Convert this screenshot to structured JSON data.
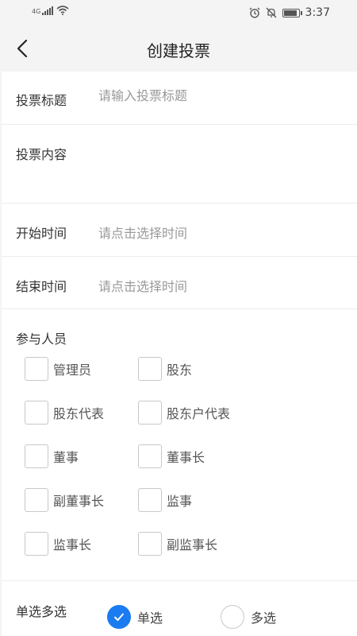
{
  "status_bar": {
    "network": "4G",
    "time": "3:37",
    "icons": [
      "signal-icon",
      "wifi-icon",
      "alarm-icon",
      "mute-icon",
      "battery-icon"
    ]
  },
  "header": {
    "title": "创建投票",
    "back_icon": "chevron-left-icon"
  },
  "form": {
    "title_field": {
      "label": "投票标题",
      "placeholder": "请输入投票标题",
      "value": ""
    },
    "content_field": {
      "label": "投票内容",
      "value": ""
    },
    "start_time": {
      "label": "开始时间",
      "placeholder": "请点击选择时间"
    },
    "end_time": {
      "label": "结束时间",
      "placeholder": "请点击选择时间"
    },
    "participants": {
      "label": "参与人员",
      "options": [
        {
          "label": "管理员",
          "checked": false
        },
        {
          "label": "股东",
          "checked": false
        },
        {
          "label": "股东代表",
          "checked": false
        },
        {
          "label": "股东户代表",
          "checked": false
        },
        {
          "label": "董事",
          "checked": false
        },
        {
          "label": "董事长",
          "checked": false
        },
        {
          "label": "副董事长",
          "checked": false
        },
        {
          "label": "监事",
          "checked": false
        },
        {
          "label": "监事长",
          "checked": false
        },
        {
          "label": "副监事长",
          "checked": false
        }
      ]
    },
    "selection_mode": {
      "label": "单选多选",
      "options": [
        {
          "label": "单选",
          "checked": true
        },
        {
          "label": "多选",
          "checked": false
        }
      ],
      "accent_color": "#1a7cf0"
    }
  }
}
